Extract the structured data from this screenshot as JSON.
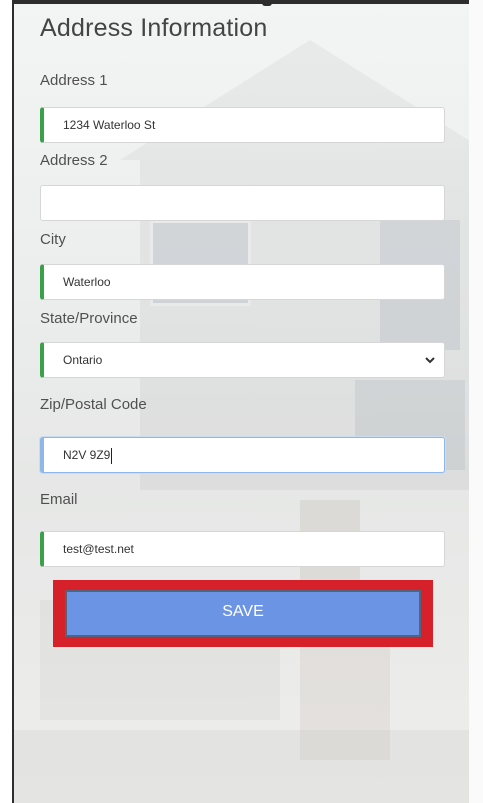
{
  "form": {
    "title": "Address Information",
    "fields": [
      {
        "label": "Address 1",
        "value": "1234 Waterloo St"
      },
      {
        "label": "Address 2",
        "value": ""
      },
      {
        "label": "City",
        "value": "Waterloo"
      },
      {
        "label": "State/Province",
        "value": "Ontario"
      },
      {
        "label": "Zip/Postal Code",
        "value": "N2V 9Z9"
      },
      {
        "label": "Email",
        "value": "test@test.net"
      }
    ],
    "save_label": "SAVE"
  },
  "colors": {
    "valid_indicator": "#3aa14a",
    "save_button": "#6b95e4",
    "highlight_box": "#d6202a"
  },
  "icons": {
    "select_arrow": "chevron-down-icon"
  }
}
